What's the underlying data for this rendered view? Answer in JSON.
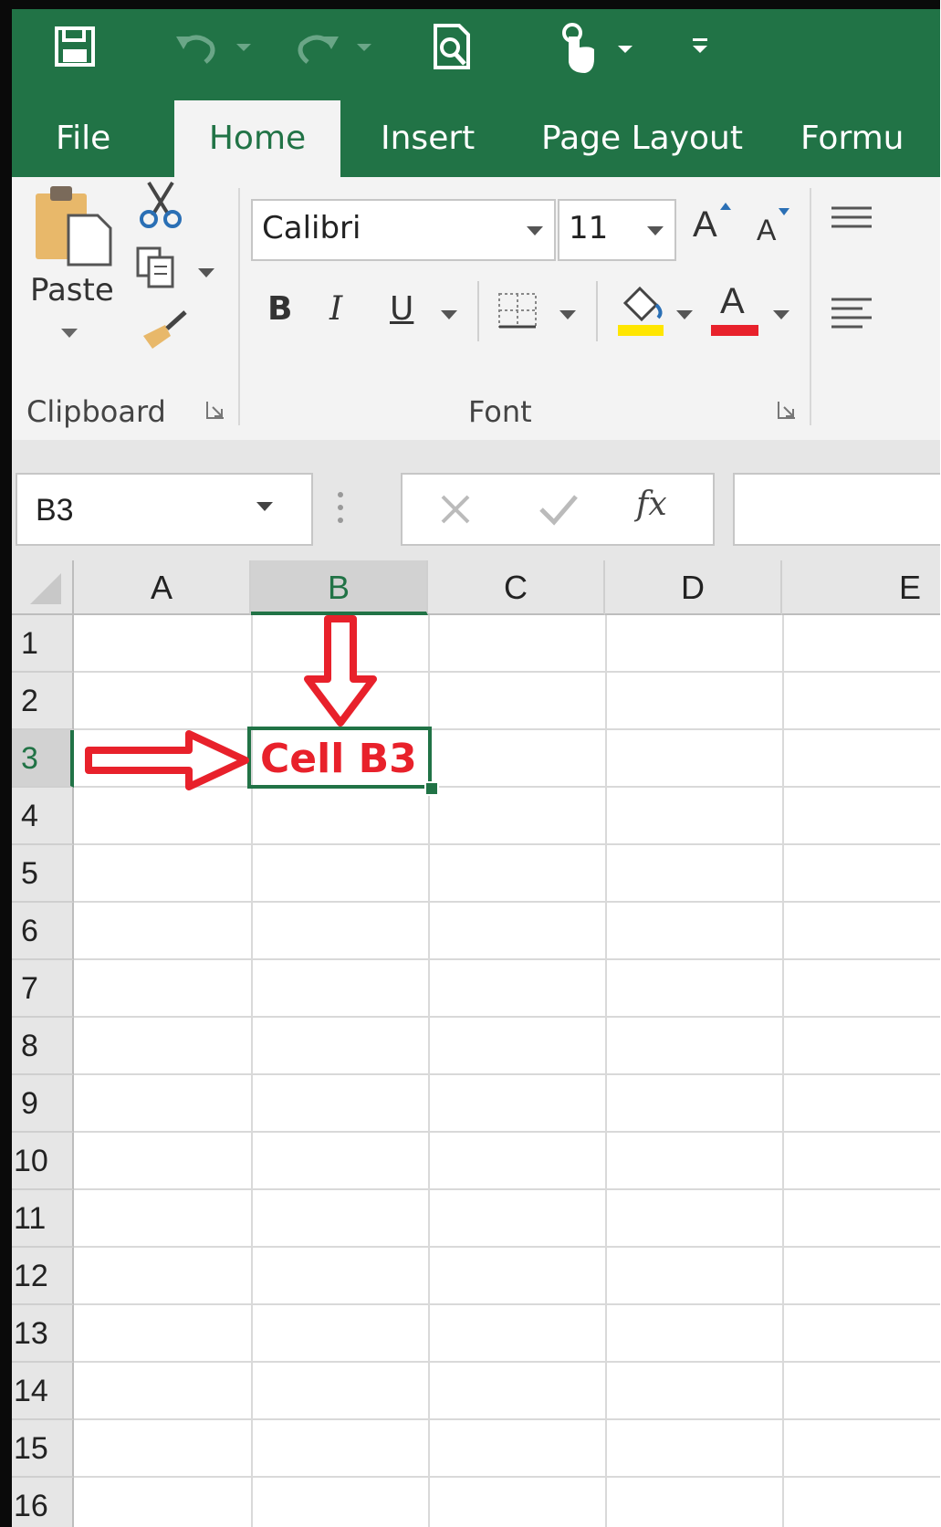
{
  "tabs": {
    "file": "File",
    "home": "Home",
    "insert": "Insert",
    "page_layout": "Page Layout",
    "formulas": "Formu"
  },
  "clipboard": {
    "paste_label": "Paste",
    "group_label": "Clipboard"
  },
  "font": {
    "name": "Calibri",
    "size": "11",
    "group_label": "Font",
    "bold": "B",
    "italic": "I",
    "underline": "U",
    "grow": "A",
    "shrink": "A",
    "font_color_glyph": "A"
  },
  "formula_bar": {
    "name_box": "B3",
    "fx": "fx"
  },
  "columns": [
    "A",
    "B",
    "C",
    "D",
    "E"
  ],
  "rows": [
    "1",
    "2",
    "3",
    "4",
    "5",
    "6",
    "7",
    "8",
    "9",
    "10",
    "11",
    "12",
    "13",
    "14",
    "15",
    "16"
  ],
  "selected": {
    "column": "B",
    "row": "3",
    "cell_text": "Cell B3"
  },
  "colors": {
    "accent": "#217346",
    "highlight_yellow": "#ffe600",
    "font_red": "#e8212b",
    "annotation_red": "#e8212b"
  }
}
